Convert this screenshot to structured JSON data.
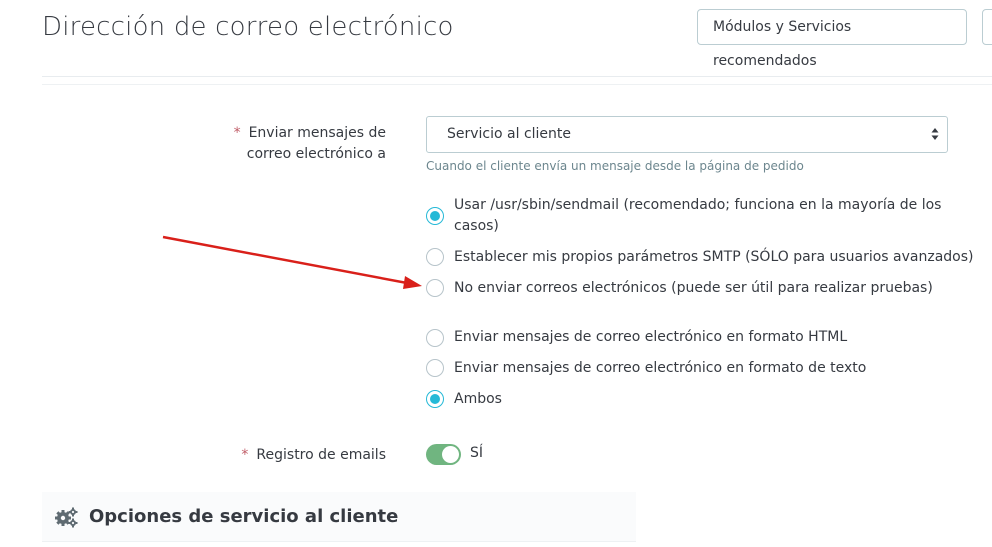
{
  "header": {
    "title": "Dirección de correo electrónico",
    "modules_button": "Módulos y Servicios recomendados"
  },
  "send_to": {
    "required_mark": "*",
    "label": "Enviar mensajes de correo electrónico a",
    "selected": "Servicio al cliente",
    "help": "Cuando el cliente envía un mensaje desde la página de pedido"
  },
  "mail_method": {
    "options": [
      {
        "label": "Usar /usr/sbin/sendmail (recomendado; funciona en la mayoría de los casos)",
        "checked": true
      },
      {
        "label": "Establecer mis propios parámetros SMTP (SÓLO para usuarios avanzados)",
        "checked": false
      },
      {
        "label": "No enviar correos electrónicos (puede ser útil para realizar pruebas)",
        "checked": false
      }
    ]
  },
  "mail_format": {
    "options": [
      {
        "label": "Enviar mensajes de correo electrónico en formato HTML",
        "checked": false
      },
      {
        "label": "Enviar mensajes de correo electrónico en formato de texto",
        "checked": false
      },
      {
        "label": "Ambos",
        "checked": true
      }
    ]
  },
  "email_log": {
    "required_mark": "*",
    "label": "Registro de emails",
    "value": "SÍ",
    "enabled": true
  },
  "panel": {
    "title": "Opciones de servicio al cliente",
    "icon": "cogs-icon"
  },
  "colors": {
    "accent": "#25b9d7",
    "toggle_on": "#70b580",
    "annotation_arrow": "#d9201a"
  }
}
